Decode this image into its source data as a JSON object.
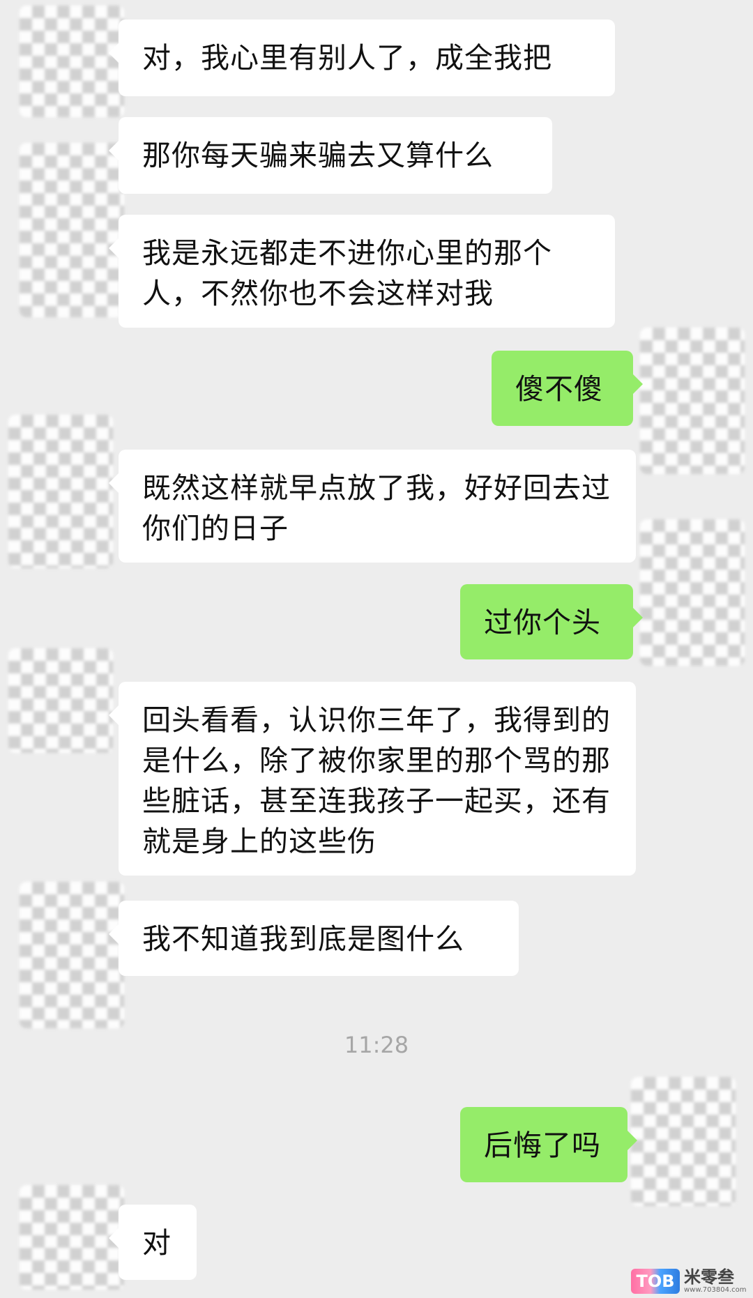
{
  "messages": [
    {
      "side": "in",
      "text": "对，我心里有别人了，成全我把"
    },
    {
      "side": "in",
      "text": "那你每天骗来骗去又算什么"
    },
    {
      "side": "in",
      "text": "我是永远都走不进你心里的那个人，不然你也不会这样对我"
    },
    {
      "side": "out",
      "text": "傻不傻"
    },
    {
      "side": "in",
      "text": "既然这样就早点放了我，好好回去过你们的日子"
    },
    {
      "side": "out",
      "text": "过你个头"
    },
    {
      "side": "in",
      "text": "回头看看，认识你三年了，我得到的是什么，除了被你家里的那个骂的那些脏话，甚至连我孩子一起买，还有就是身上的这些伤"
    },
    {
      "side": "in",
      "text": "我不知道我到底是图什么"
    },
    {
      "side": "out",
      "text": "后悔了吗"
    },
    {
      "side": "in",
      "text": "对"
    }
  ],
  "timestamp": "11:28",
  "watermark": {
    "logo": "TOB",
    "name": "米零叁",
    "url": "www.703804.com"
  },
  "colors": {
    "background": "#ededed",
    "incoming_bubble": "#ffffff",
    "outgoing_bubble": "#95ec69",
    "timestamp": "#a6a6a6"
  }
}
